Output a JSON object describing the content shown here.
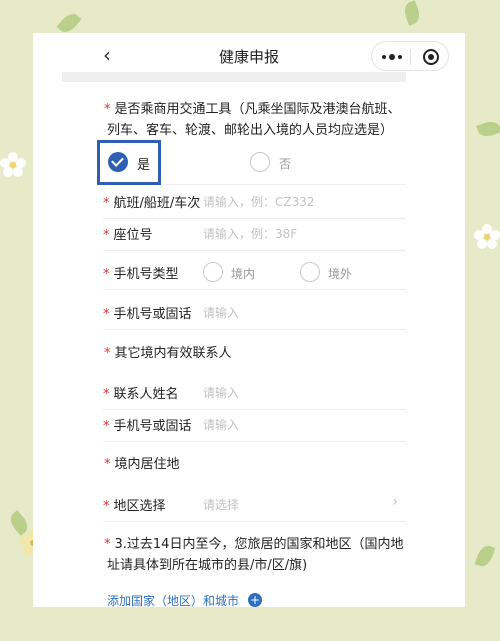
{
  "nav": {
    "title": "健康申报",
    "back_icon": "chevron-left-icon",
    "more_icon": "more-dots-icon",
    "close_icon": "target-close-icon"
  },
  "form": {
    "q_transport": "是否乘商用交通工具（凡乘坐国际及港澳台航班、",
    "q_transport_line2": "列车、客车、轮渡、邮轮出入境的人员均应选是）",
    "opt_yes": "是",
    "opt_no": "否",
    "flight_label": "航班/船班/车次",
    "flight_placeholder": "请输入，例：CZ332",
    "seat_label": "座位号",
    "seat_placeholder": "请输入，例：38F",
    "phone_type_label": "手机号类型",
    "phone_type_domestic": "境内",
    "phone_type_foreign": "境外",
    "phone_label": "手机号或固话",
    "phone_placeholder": "请输入",
    "other_contact_title": "其它境内有效联系人",
    "contact_name_label": "联系人姓名",
    "contact_name_placeholder": "请输入",
    "contact_phone_label": "手机号或固话",
    "contact_phone_placeholder": "请输入",
    "residence_title": "境内居住地",
    "region_label": "地区选择",
    "region_placeholder": "请选择",
    "q3_line1": "3.过去14日内至今，您旅居的国家和地区（国内地",
    "q3_line2": "址请具体到所在城市的县/市/区/旗)",
    "add_link": "添加国家（地区）和城市"
  },
  "colors": {
    "accent": "#2f5fb3",
    "required_star": "#d0342c",
    "link": "#2f6fc0",
    "background": "#e6eac8"
  }
}
